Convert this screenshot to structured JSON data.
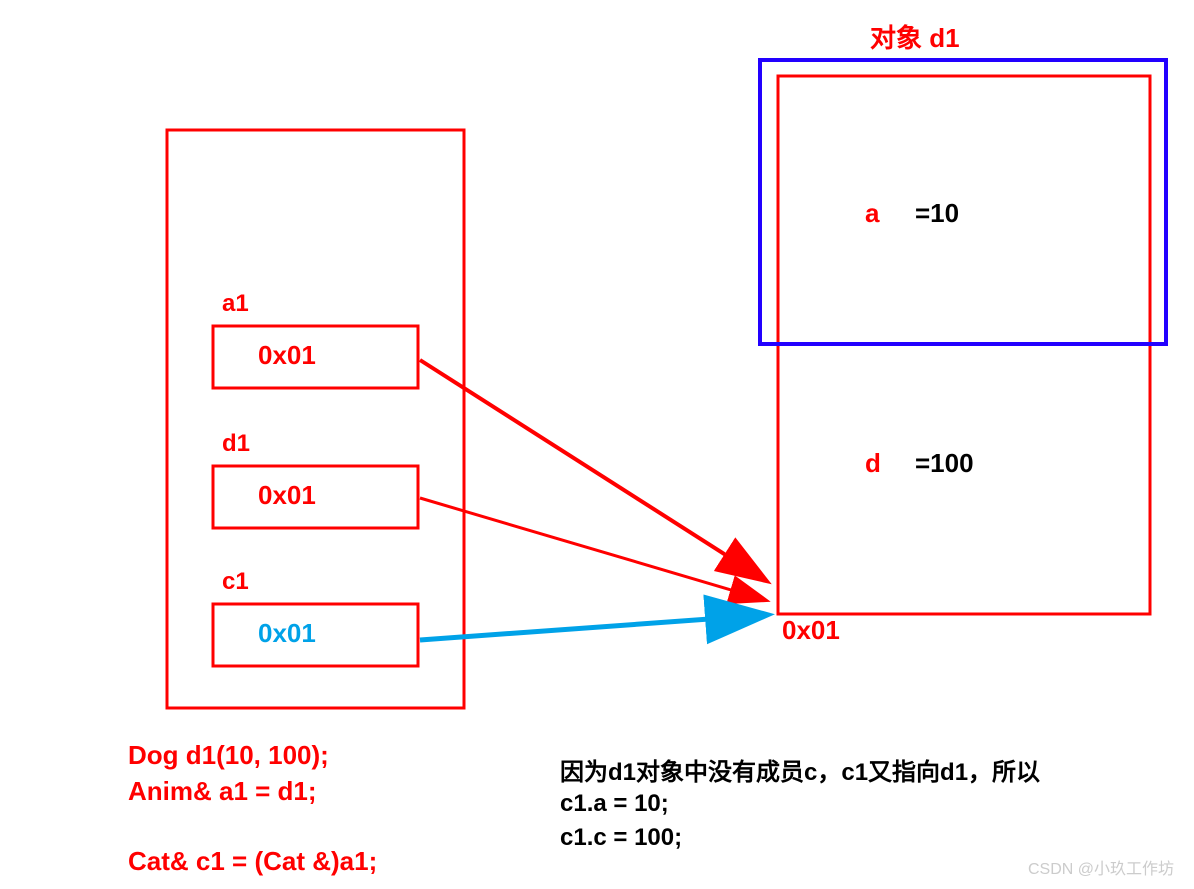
{
  "title_right": "对象 d1",
  "stack": {
    "a1": {
      "label": "a1",
      "value": "0x01"
    },
    "d1": {
      "label": "d1",
      "value": "0x01"
    },
    "c1": {
      "label": "c1",
      "value": "0x01"
    }
  },
  "object": {
    "a": {
      "name": "a",
      "value": "=10"
    },
    "d": {
      "name": "d",
      "value": "=100"
    },
    "address": "0x01"
  },
  "code": {
    "line1": "Dog d1(10, 100);",
    "line2": "Anim& a1 = d1;",
    "line3": "Cat& c1 = (Cat &)a1;"
  },
  "explanation": {
    "line1": "因为d1对象中没有成员c，c1又指向d1，所以",
    "line2": "c1.a = 10;",
    "line3": "c1.c = 100;"
  },
  "watermark": "CSDN @小玖工作坊"
}
